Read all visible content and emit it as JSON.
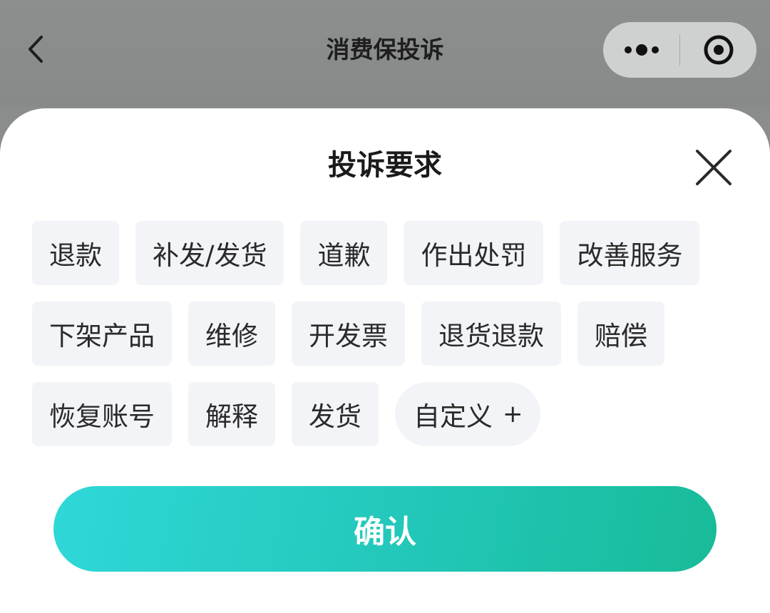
{
  "header": {
    "title": "消费保投诉",
    "back_icon": "chevron-left-icon",
    "more_icon": "more-dots-icon",
    "close_icon": "target-circle-icon"
  },
  "sheet": {
    "title": "投诉要求",
    "close_icon": "close-x-icon",
    "tags": [
      [
        "退款",
        "补发/发货",
        "道歉",
        "作出处罚",
        "改善服务"
      ],
      [
        "下架产品",
        "维修",
        "开发票",
        "退货退款",
        "赔偿"
      ],
      [
        "恢复账号",
        "解释",
        "发货"
      ]
    ],
    "custom_tag": {
      "label": "自定义",
      "plus": "+"
    },
    "confirm_label": "确认"
  },
  "colors": {
    "accent_start": "#2fd8d8",
    "accent_end": "#18bb98",
    "tag_bg": "#f2f4f7",
    "overlay": "#8a8d8c"
  }
}
